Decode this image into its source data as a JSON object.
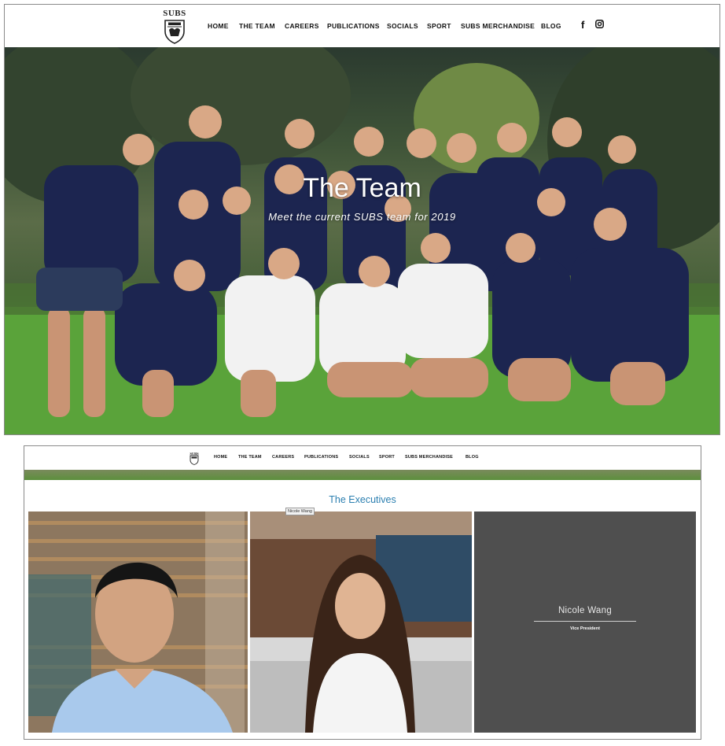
{
  "site": {
    "logo_text": "SUBS",
    "nav": [
      "HOME",
      "THE TEAM",
      "CAREERS",
      "PUBLICATIONS",
      "SOCIALS",
      "SPORT",
      "SUBS MERCHANDISE",
      "BLOG"
    ],
    "social_icons": [
      "facebook-icon",
      "instagram-icon"
    ]
  },
  "hero": {
    "title": "The Team",
    "subtitle": "Meet the current SUBS team for 2019"
  },
  "executives": {
    "heading": "The Executives",
    "tooltip": "Nicole Wang",
    "members": [
      {
        "name": "Nicole Wang",
        "role": "Vice President"
      }
    ]
  },
  "colors": {
    "accent": "#2b7fb0",
    "card_overlay": "#4f4f4f",
    "shirt": "#1c2550",
    "grass": "#57a13a"
  }
}
